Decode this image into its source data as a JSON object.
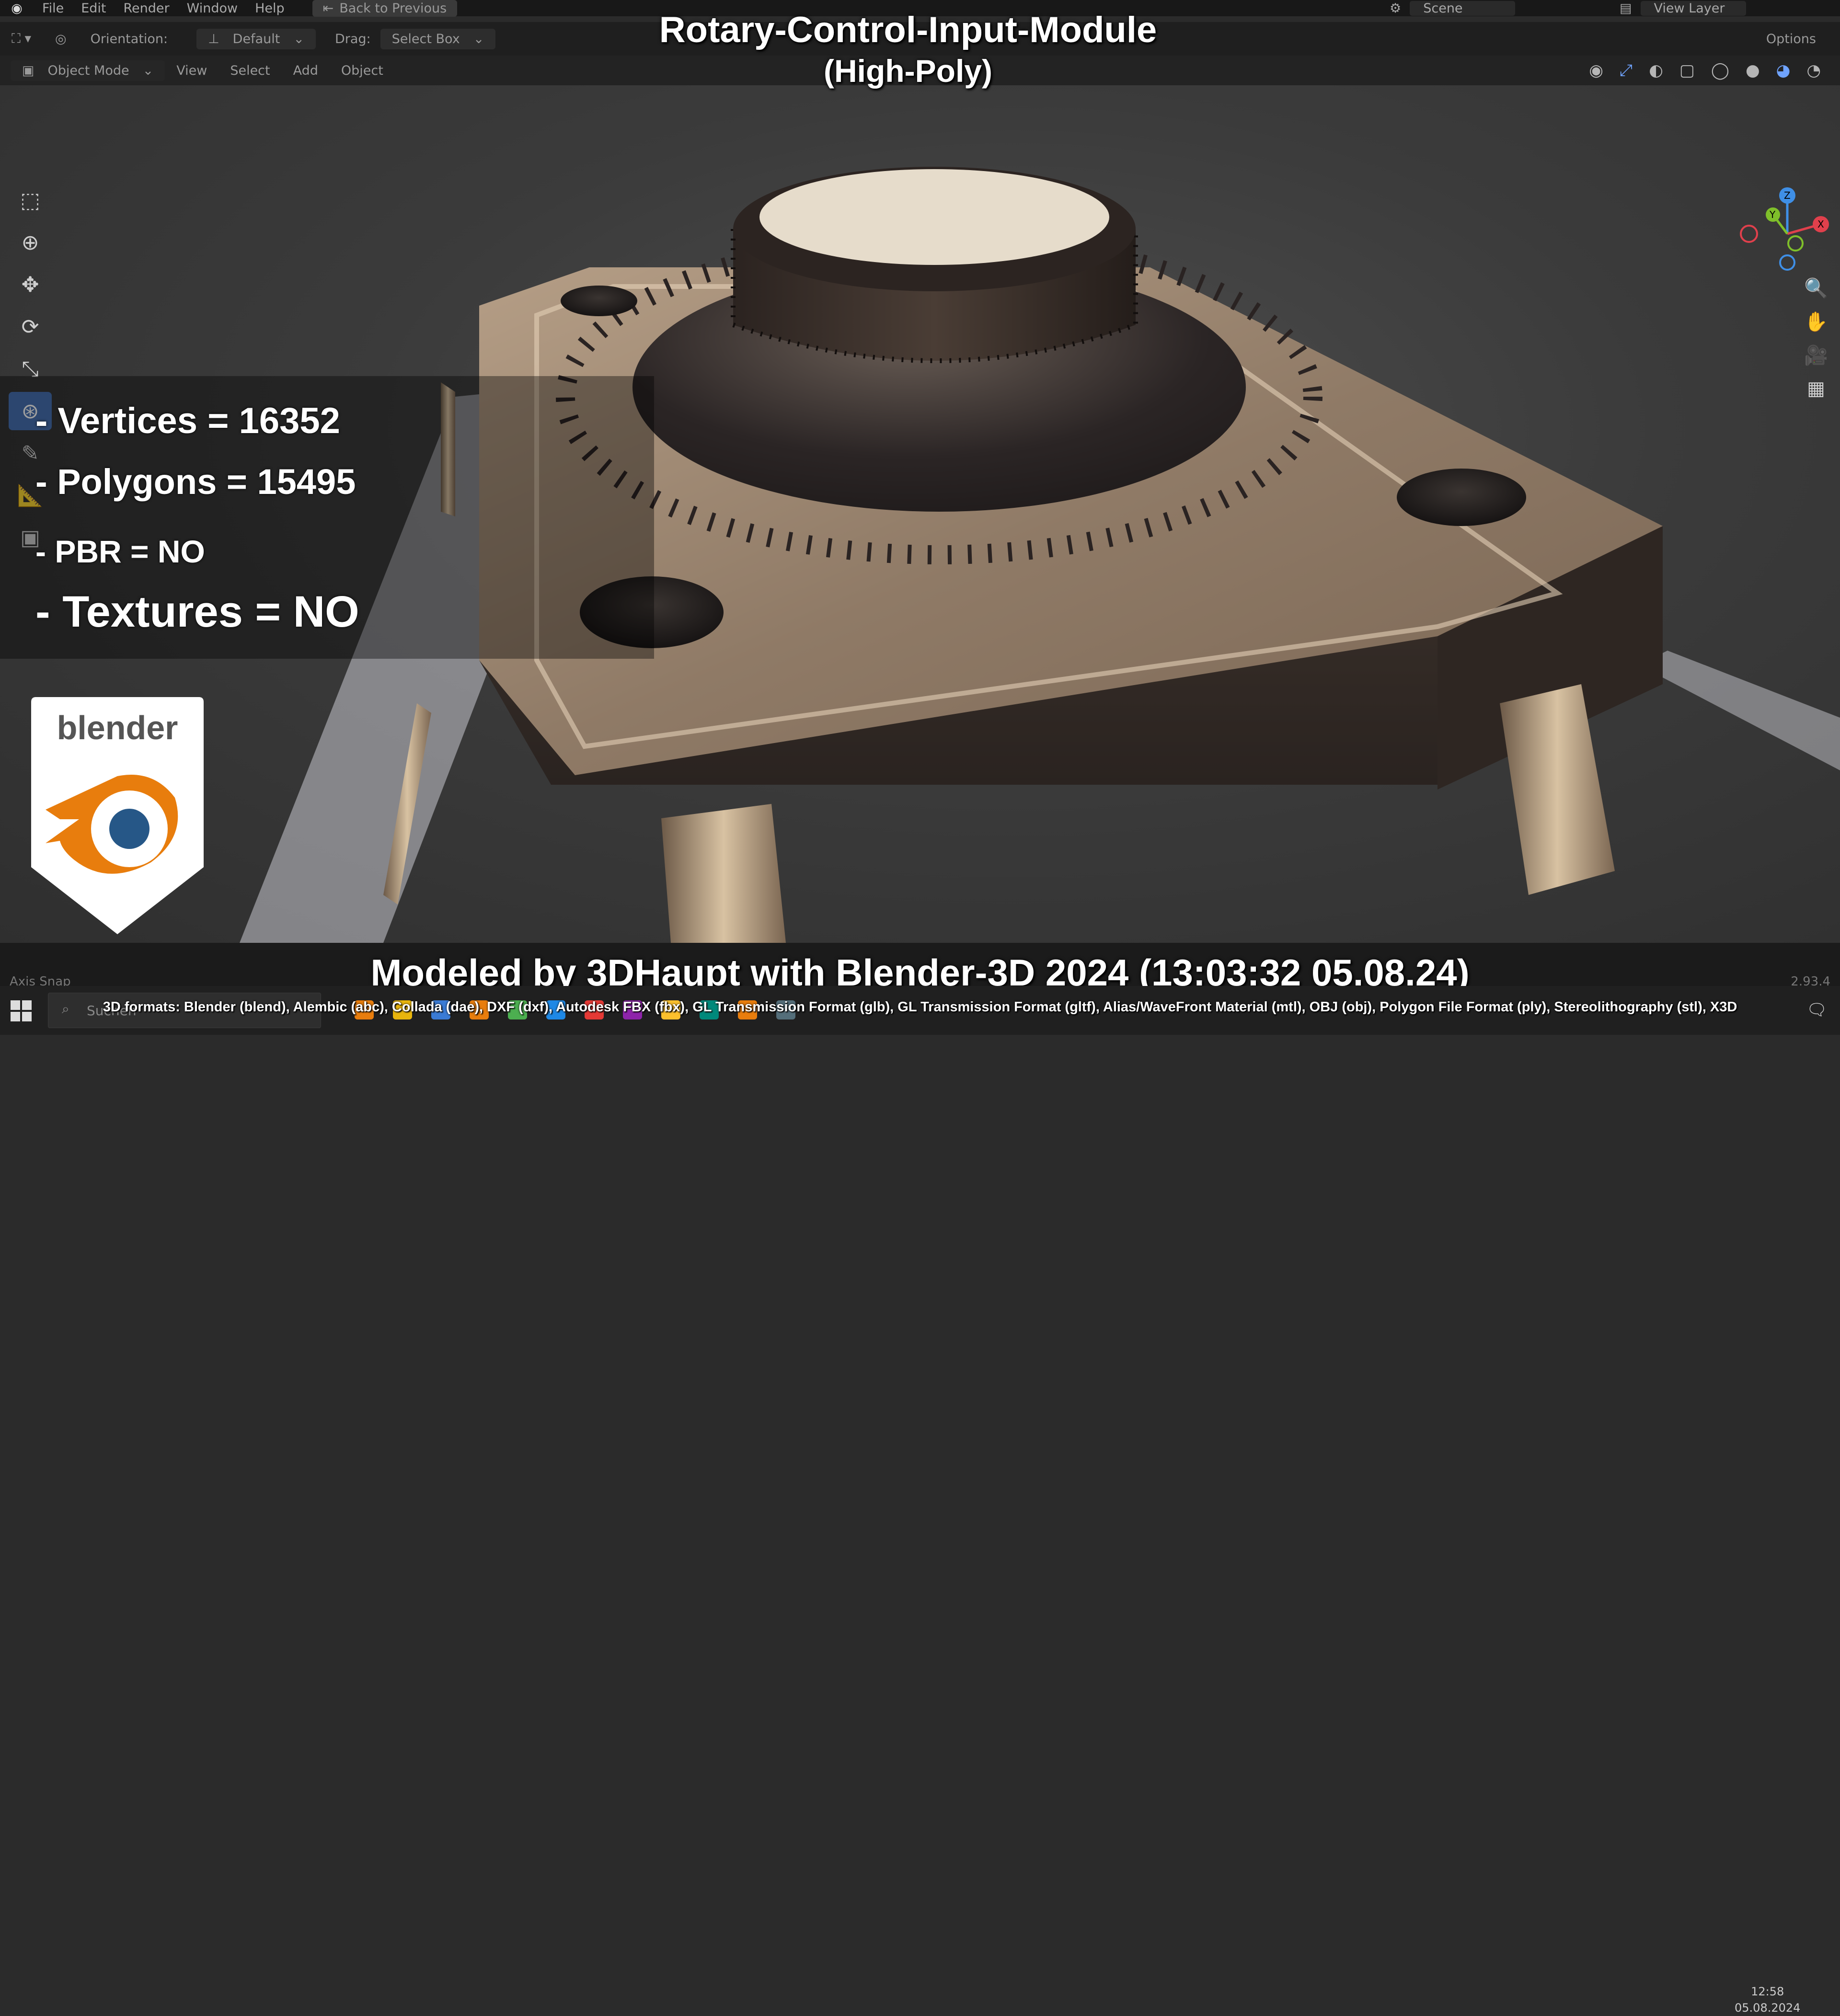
{
  "topbar": {
    "menus": [
      "File",
      "Edit",
      "Render",
      "Window",
      "Help"
    ],
    "back_button": "Back to Previous",
    "scene": "Scene",
    "view_layer": "View Layer"
  },
  "header": {
    "orientation_label": "Orientation:",
    "orientation_value": "Default",
    "drag_label": "Drag:",
    "drag_value": "Select Box",
    "options": "Options",
    "mode": "Object Mode",
    "menus": [
      "View",
      "Select",
      "Add",
      "Object"
    ]
  },
  "overlay": {
    "title_line1": "Rotary-Control-Input-Module",
    "title_line2": "(High-Poly)",
    "vertices": "- Vertices = 16352",
    "polygons": "- Polygons = 15495",
    "pbr": "- PBR =  NO",
    "textures": "- Textures = NO",
    "badge_text": "blender",
    "credit": "Modeled by 3DHaupt with Blender-3D 2024 (13:03:32  05.08.24)",
    "formats": "3D formats: Blender (blend), Alembic (abc), Collada (dae), DXF (dxf), Autodesk FBX (fbx), GL Transmission Format (glb), GL Transmission Format (gltf), Alias/WaveFront Material (mtl), OBJ (obj), Polygon File Format (ply), Stereolithography (stl), X3D"
  },
  "statusbar": {
    "axis_snap": "Axis Snap",
    "version": "2.93.4"
  },
  "taskbar": {
    "search_placeholder": "Suchen",
    "time": "12:58",
    "date": "05.08.2024"
  },
  "gizmo": {
    "axes": [
      "X",
      "Y",
      "Z"
    ],
    "colors": {
      "x": "#e0404c",
      "y": "#7fbf2a",
      "z": "#3f8fe6"
    }
  },
  "colors": {
    "accent": "#4772b3",
    "blender_orange": "#e87d0d",
    "blender_blue": "#265787"
  }
}
